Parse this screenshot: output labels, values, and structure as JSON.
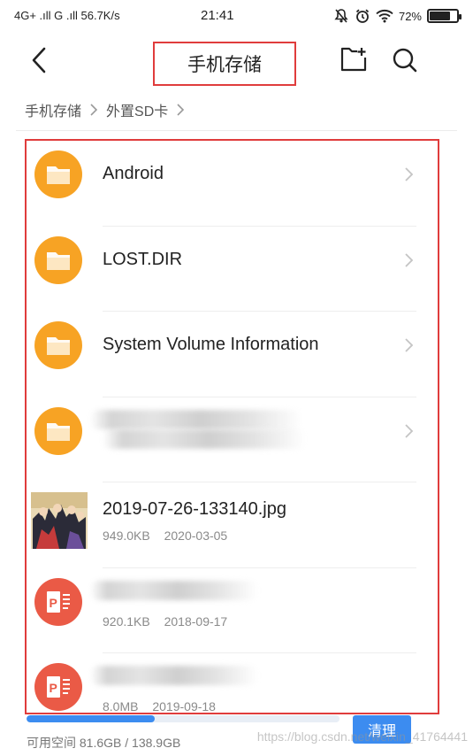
{
  "status_bar": {
    "left": "4G+ .ıll G .ıll 56.7K/s",
    "time": "21:41",
    "battery": "72%",
    "battery_level": 0.72
  },
  "header": {
    "title": "手机存储",
    "icons": [
      "back-icon",
      "new-folder-icon",
      "search-icon"
    ]
  },
  "breadcrumb": {
    "items": [
      "手机存储",
      "外置SD卡"
    ]
  },
  "files": [
    {
      "name": "Android",
      "type": "folder"
    },
    {
      "name": "LOST.DIR",
      "type": "folder"
    },
    {
      "name": "System Volume Information",
      "type": "folder"
    },
    {
      "name": "",
      "type": "folder",
      "blurred": true
    },
    {
      "name": "2019-07-26-133140.jpg",
      "type": "image",
      "size": "949.0KB",
      "date": "2020-03-05"
    },
    {
      "name": "",
      "type": "ppt",
      "blurred": true,
      "size": "920.1KB",
      "date": "2018-09-17"
    },
    {
      "name": "",
      "type": "ppt",
      "blurred": true,
      "size": "8.0MB",
      "date": "2019-09-18"
    }
  ],
  "storage": {
    "label": "可用空间 81.6GB / 138.9GB",
    "used_fraction": 0.41,
    "clean_button": "清理"
  },
  "watermark": "https://blog.csdn.net/weixin_41764441",
  "colors": {
    "folder": "#f7a324",
    "ppt": "#ea5a46",
    "accent": "#3c8cf0",
    "highlight_border": "#e03c3c"
  }
}
